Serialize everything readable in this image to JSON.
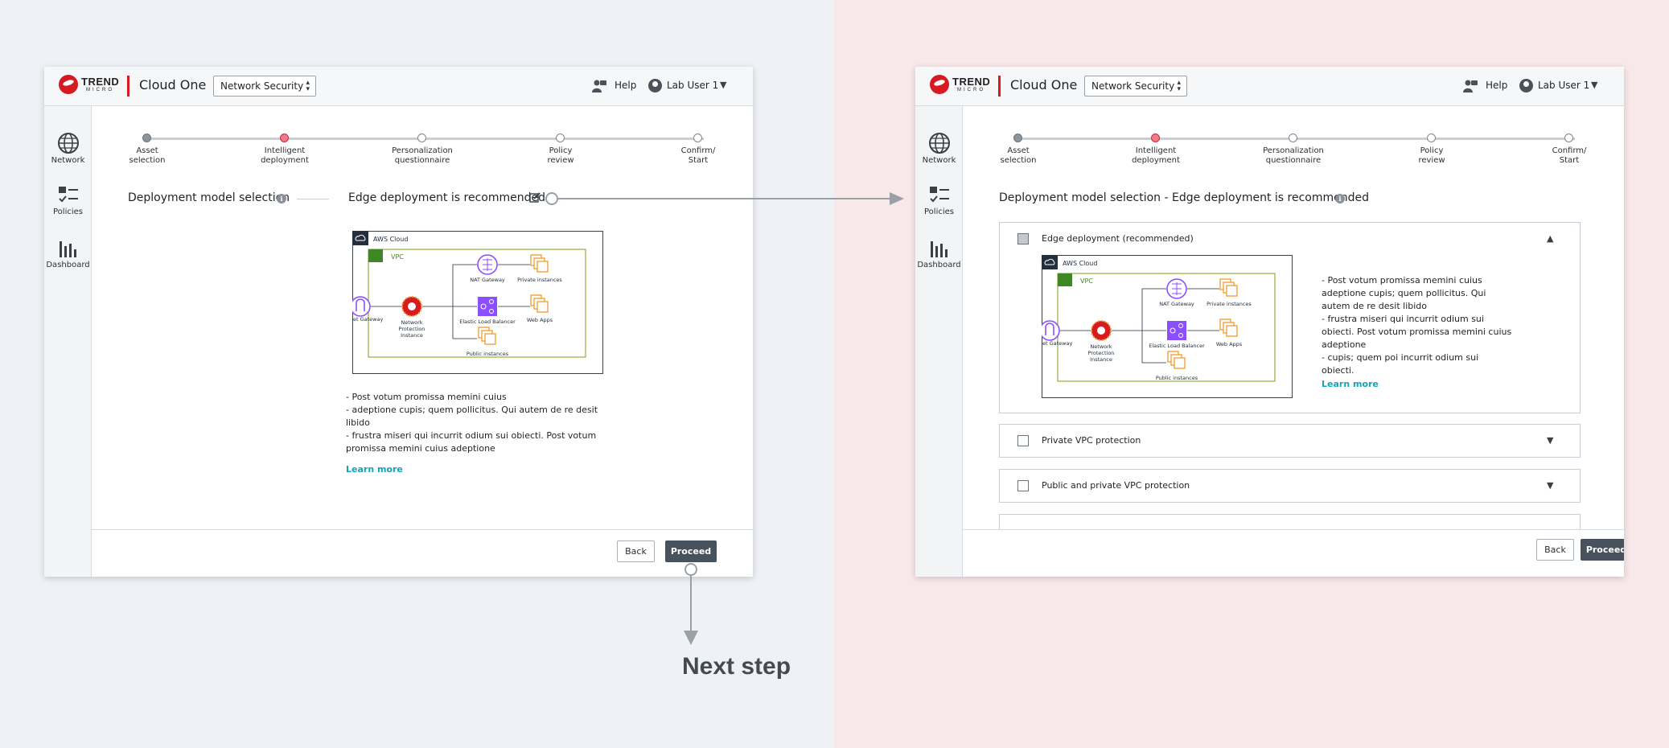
{
  "brand": {
    "logo_text": "TREND",
    "logo_sub": "MICRO",
    "app_title": "Cloud One",
    "accent": "#d71920"
  },
  "header": {
    "service": "Network Security",
    "help": "Help",
    "user": "Lab User 1"
  },
  "sidebar": [
    {
      "label": "Network",
      "icon": "globe-icon"
    },
    {
      "label": "Policies",
      "icon": "checklist-icon"
    },
    {
      "label": "Dashboard",
      "icon": "bar-chart-icon"
    }
  ],
  "steps": [
    {
      "line1": "Asset",
      "line2": "selection",
      "state": "done"
    },
    {
      "line1": "Intelligent",
      "line2": "deployment",
      "state": "current"
    },
    {
      "line1": "Personalization",
      "line2": "questionnaire",
      "state": "todo"
    },
    {
      "line1": "Policy",
      "line2": "review",
      "state": "todo"
    },
    {
      "line1": "Confirm/",
      "line2": "Start",
      "state": "todo"
    }
  ],
  "left_screen": {
    "title": "Deployment model selection",
    "recommendation": "Edge deployment is recommended",
    "desc_lines": [
      "- Post votum promissa memini cuius",
      "- adeptione cupis; quem pollicitus. Qui autem de re desit",
      "libido",
      "- frustra miseri qui incurrit odium sui obiecti. Post votum",
      "promissa memini cuius adeptione"
    ],
    "learn_more": "Learn more"
  },
  "right_screen": {
    "title": "Deployment model selection - Edge deployment is recommended",
    "options": [
      {
        "label": "Edge deployment (recommended)",
        "expanded": true
      },
      {
        "label": "Private VPC protection",
        "expanded": false
      },
      {
        "label": "Public and private VPC protection",
        "expanded": false
      }
    ],
    "desc_lines": [
      "- Post votum promissa memini cuius",
      "adeptione cupis; quem pollicitus. Qui",
      "autem de re desit libido",
      "- frustra miseri qui incurrit odium sui",
      "obiecti. Post votum promissa memini cuius",
      "adeptione",
      "- cupis; quem poi incurrit odium sui",
      "obiecti."
    ],
    "learn_more": "Learn more"
  },
  "diagram": {
    "cloud": "AWS Cloud",
    "vpc": "VPC",
    "nat": "NAT Gateway",
    "private": "Private instances",
    "igw": "Internet Gateway",
    "npi_1": "Network",
    "npi_2": "Protection",
    "npi_3": "Instance",
    "elb": "Elastic Load Balancer",
    "webapps": "Web Apps",
    "public": "Public instances"
  },
  "buttons": {
    "back": "Back",
    "proceed": "Proceed"
  },
  "annotation": {
    "next_step": "Next step"
  }
}
